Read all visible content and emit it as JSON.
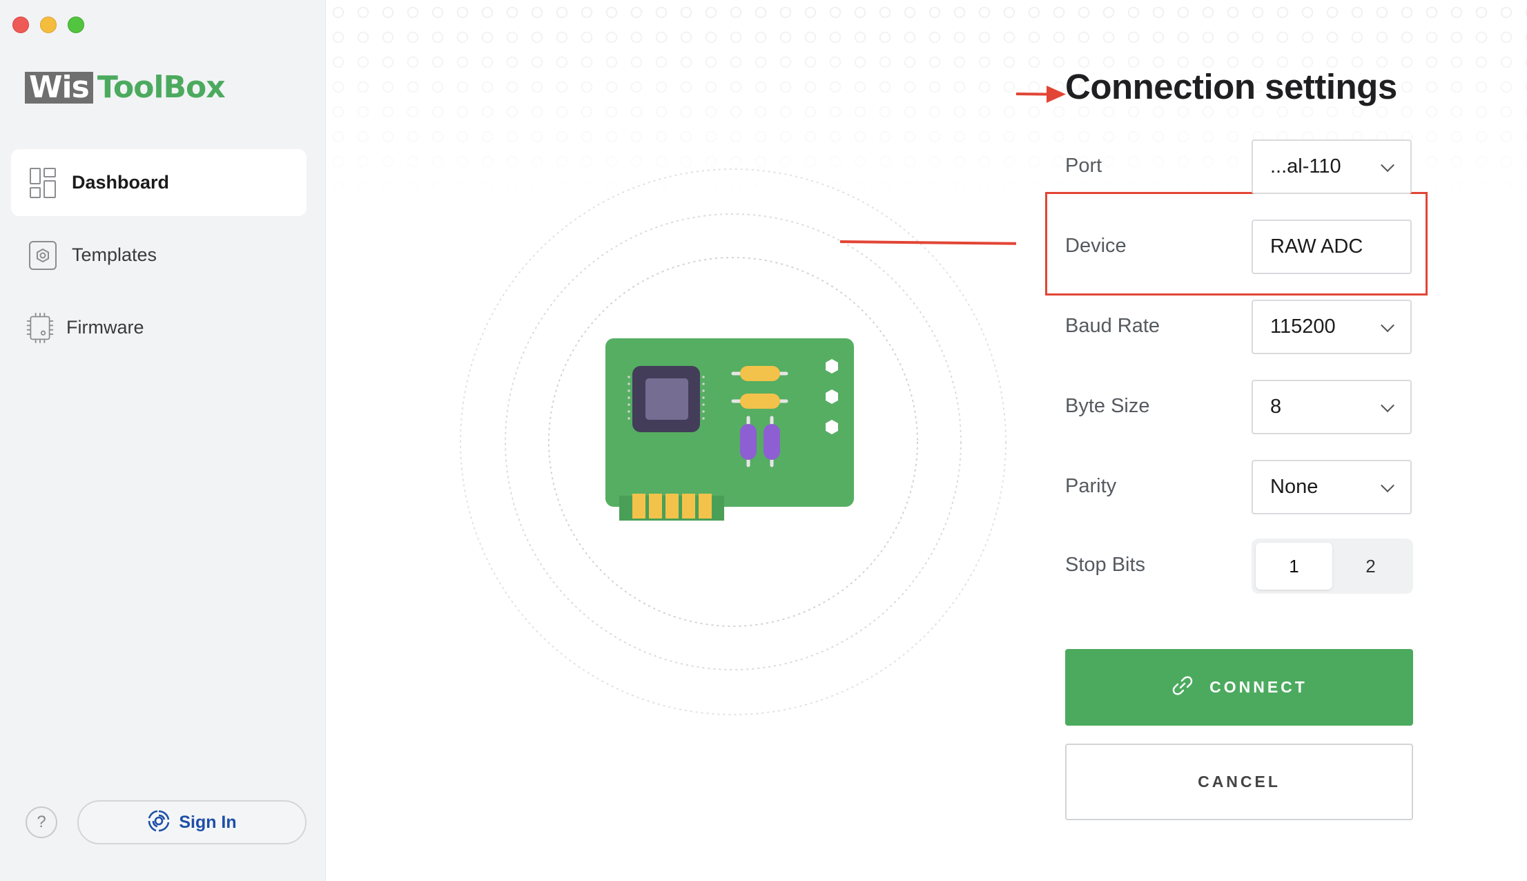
{
  "app": {
    "logo_wis": "Wis",
    "logo_toolbox": "ToolBox"
  },
  "sidebar": {
    "items": [
      {
        "label": "Dashboard",
        "icon": "dashboard-icon",
        "active": true
      },
      {
        "label": "Templates",
        "icon": "templates-icon",
        "active": false
      },
      {
        "label": "Firmware",
        "icon": "firmware-chip-icon",
        "active": false
      }
    ],
    "help_icon": "?",
    "sign_in_label": "Sign In"
  },
  "settings": {
    "title": "Connection settings",
    "port": {
      "label": "Port",
      "value": "...al-110"
    },
    "device": {
      "label": "Device",
      "value": "RAW ADC"
    },
    "baud_rate": {
      "label": "Baud Rate",
      "value": "115200"
    },
    "byte_size": {
      "label": "Byte Size",
      "value": "8"
    },
    "parity": {
      "label": "Parity",
      "value": "None"
    },
    "stop_bits": {
      "label": "Stop Bits",
      "options": [
        "1",
        "2"
      ],
      "selected": "1"
    },
    "connect_label": "CONNECT",
    "cancel_label": "CANCEL"
  },
  "colors": {
    "accent_green": "#4caa5f",
    "annotation_red": "#e24535",
    "sign_in_blue": "#1e4fa8"
  }
}
